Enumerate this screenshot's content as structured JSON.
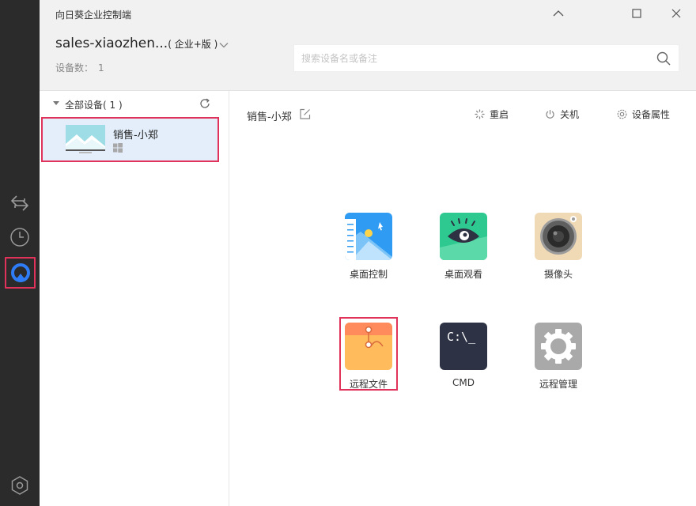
{
  "window": {
    "title": "向日葵企业控制端"
  },
  "account": {
    "name": "sales-xiaozhen...",
    "edition": "( 企业+版 )",
    "device_count_label": "设备数：",
    "device_count": "1"
  },
  "search": {
    "placeholder": "搜索设备名或备注",
    "value": ""
  },
  "device_group": {
    "label": "全部设备( 1 )"
  },
  "devices": [
    {
      "name": "销售-小郑",
      "os_icon": "windows-icon"
    }
  ],
  "detail": {
    "device_title": "销售-小郑",
    "actions": {
      "restart": "重启",
      "shutdown": "关机",
      "properties": "设备属性"
    },
    "tiles": {
      "remote_desktop": "桌面控制",
      "desktop_view": "桌面观看",
      "camera": "摄像头",
      "remote_file": "远程文件",
      "cmd": "CMD",
      "remote_manage": "远程管理"
    },
    "cmd_icon_text": "C:\\_"
  },
  "colors": {
    "highlight_border": "#e0325a",
    "selected_row": "#e3eefa",
    "rail": "#2b2b2b",
    "header": "#f1f1f1",
    "active_rail_icon": "#2e7cf6"
  },
  "icons": {
    "rail": [
      "remote-transfer-icon",
      "history-clock-icon",
      "sunlogin-device-icon",
      "settings-hexagon-icon"
    ],
    "header": [
      "minimize-up-icon",
      "maximize-icon",
      "close-icon",
      "chevron-down-icon",
      "search-icon"
    ]
  }
}
